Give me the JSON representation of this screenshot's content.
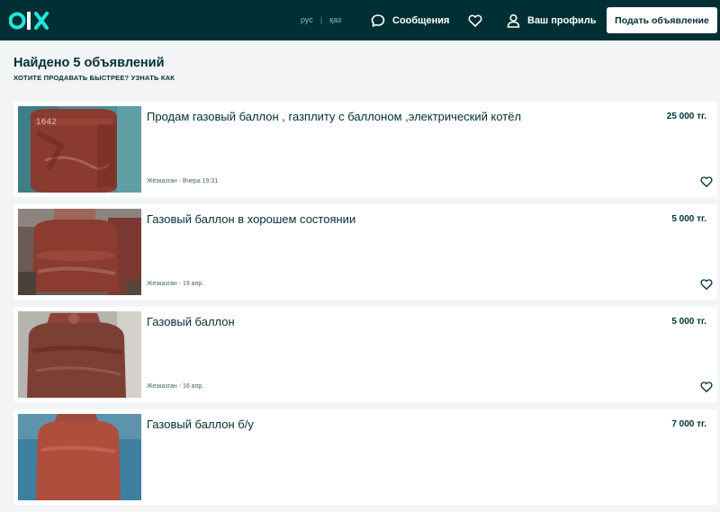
{
  "header": {
    "logo": "OLX",
    "lang": [
      "рус",
      "қаз"
    ],
    "lang_sep": "|",
    "messages_label": "Сообщения",
    "profile_label": "Ваш профиль",
    "post_button_label": "Подать объявление"
  },
  "results": {
    "title": "Найдено 5 объявлений",
    "subtitle": "ХОТИТЕ ПРОДАВАТЬ БЫСТРЕЕ? УЗНАТЬ КАК"
  },
  "listings": [
    {
      "title": "Продам газовый баллон , газплиту с баллоном ,электрический котёл",
      "price": "25 000 тг.",
      "meta": "Жезказган - Вчера 19:31"
    },
    {
      "title": "Газовый баллон в хорошем состоянии",
      "price": "5 000 тг.",
      "meta": "Жезказган - 19 апр."
    },
    {
      "title": "Газовый баллон",
      "price": "5 000 тг.",
      "meta": "Жезказган - 16 апр."
    },
    {
      "title": "Газовый баллон б/у",
      "price": "7 000 тг.",
      "meta": ""
    }
  ],
  "colors": {
    "header_bg": "#002f34",
    "accent": "#23e5db",
    "page_bg": "#f2f4f5",
    "text": "#002f34"
  }
}
